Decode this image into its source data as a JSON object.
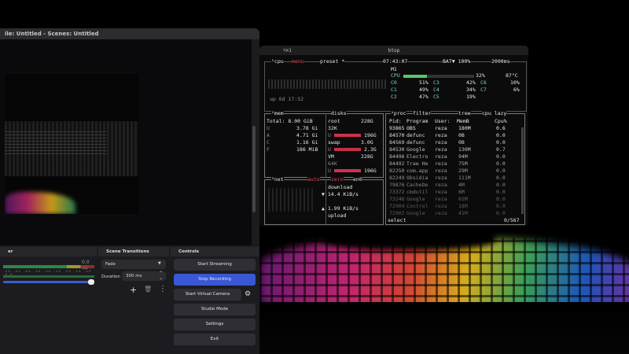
{
  "obs": {
    "title": "ile: Untitled - Scenes: Untitled",
    "mixer": {
      "title": "er",
      "db_value": "0.0 dB",
      "scale_text": "-50 -45 -40 -35 -30 -25 -20 -15 -10 -5 0"
    },
    "transitions": {
      "title": "Scene Transitions",
      "selected": "Fade",
      "duration_label": "Duration",
      "duration_value": "300 ms"
    },
    "controls": {
      "title": "Controls",
      "start_streaming": "Start Streaming",
      "stop_recording": "Stop Recording",
      "start_virtual_camera": "Start Virtual Camera",
      "studio_mode": "Studio Mode",
      "settings": "Settings",
      "exit": "Exit"
    },
    "colors": {
      "record_button": "#3a57d6",
      "panel_bg": "#1c1c20"
    }
  },
  "terminal": {
    "short_title": "⌥⌘1",
    "title": "btop",
    "cpu": {
      "header_left": "¹cpu",
      "menu": "menu",
      "preset": "preset *",
      "time": "07:43:07",
      "battery": "BAT▼ 100%",
      "interval": "2000ms",
      "model": "M1",
      "total_label": "CPU",
      "total_pct": "32%",
      "temp": "87°C",
      "cores": [
        {
          "label": "C0",
          "pct": "51%"
        },
        {
          "label": "C3",
          "pct": "42%"
        },
        {
          "label": "C6",
          "pct": "10%"
        },
        {
          "label": "C1",
          "pct": "49%"
        },
        {
          "label": "C4",
          "pct": "34%"
        },
        {
          "label": "C7",
          "pct": "6%"
        },
        {
          "label": "C2",
          "pct": "47%"
        },
        {
          "label": "C5",
          "pct": "19%"
        }
      ],
      "uptime": "up 6d 17:52"
    },
    "mem": {
      "title": "²mem",
      "total": "Total: 8.00 GiB",
      "used": "3.78 Gi",
      "available": "4.71 Gi",
      "cached": "1.16 Gi",
      "free": "186 MiB",
      "labels": [
        "U",
        "A",
        "C",
        "F"
      ]
    },
    "disks": {
      "title": "disks",
      "root_label": "root",
      "root_size": "228G",
      "root_io": "32K",
      "root_used": "196G",
      "swap_label": "swap",
      "swap_size": "3.0G",
      "swap_used": "2.3G",
      "vm_label": "VM",
      "vm_size": "228G",
      "vm_io": "64K",
      "vm_used": "196G"
    },
    "net": {
      "title": "³net",
      "auto": "auto",
      "zero": "zero",
      "iface": "en0",
      "download_label": "download",
      "download_rate": "▼ 14.4 KiB/s",
      "upload_rate": "▲ 1.99 KiB/s",
      "upload_label": "upload"
    },
    "proc": {
      "title": "⁴proc",
      "filter": "filter",
      "tree": "tree",
      "sort": "cpu lazy",
      "headers": [
        "Pid:",
        "Program",
        "User:",
        "MemB",
        "Cpu%"
      ],
      "rows": [
        {
          "pid": "93865",
          "program": "OBS",
          "user": "reza",
          "mem": "180M",
          "cpu": "0.6"
        },
        {
          "pid": "84570",
          "program": "defunc",
          "user": "reza",
          "mem": "0B",
          "cpu": "0.0"
        },
        {
          "pid": "84569",
          "program": "defunc",
          "user": "reza",
          "mem": "0B",
          "cpu": "0.0"
        },
        {
          "pid": "84530",
          "program": "Google",
          "user": "reza",
          "mem": "130M",
          "cpu": "0.7"
        },
        {
          "pid": "84496",
          "program": "Electro",
          "user": "reza",
          "mem": "94M",
          "cpu": "0.0"
        },
        {
          "pid": "84492",
          "program": "Trae He",
          "user": "reza",
          "mem": "75M",
          "cpu": "0.0"
        },
        {
          "pid": "82250",
          "program": "com.app",
          "user": "reza",
          "mem": "29M",
          "cpu": "0.0"
        },
        {
          "pid": "82249",
          "program": "Obsidia",
          "user": "reza",
          "mem": "111M",
          "cpu": "0.0"
        },
        {
          "pid": "79876",
          "program": "CacheDe",
          "user": "reza",
          "mem": "4M",
          "cpu": "0.0"
        },
        {
          "pid": "73372",
          "program": "cmdutil",
          "user": "reza",
          "mem": "6M",
          "cpu": "0.0"
        },
        {
          "pid": "73246",
          "program": "Google",
          "user": "reza",
          "mem": "61M",
          "cpu": "0.0"
        },
        {
          "pid": "72904",
          "program": "Control",
          "user": "reza",
          "mem": "18M",
          "cpu": "0.0"
        },
        {
          "pid": "72902",
          "program": "Google",
          "user": "reza",
          "mem": "41M",
          "cpu": "0.0"
        }
      ],
      "footer_select": "select",
      "footer_count": "0/567"
    }
  }
}
